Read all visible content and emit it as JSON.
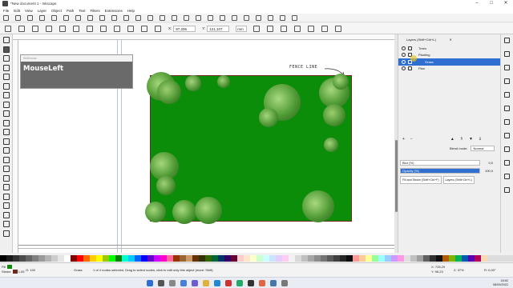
{
  "window": {
    "title": "*New document 1 - Inkscape"
  },
  "menu": [
    "File",
    "Edit",
    "View",
    "Layer",
    "Object",
    "Path",
    "Text",
    "Filters",
    "Extensions",
    "Help"
  ],
  "tool_controls": {
    "x_label": "X:",
    "x_value": "97,206",
    "y_label": "Y:",
    "y_value": "121,107",
    "unit": "mm"
  },
  "overlay": {
    "header": "Shift/mods",
    "text": "MouseLeft"
  },
  "canvas": {
    "annotation": "FENCE LINE"
  },
  "layers_panel": {
    "tab_label": "Layers (Shift+Ctrl+L)",
    "layers": [
      {
        "name": "Trees",
        "selected": false,
        "sub": false
      },
      {
        "name": "Planting",
        "selected": false,
        "sub": false
      },
      {
        "name": "Grass",
        "selected": true,
        "sub": true
      },
      {
        "name": "Plan",
        "selected": false,
        "sub": false
      }
    ],
    "blend_label": "Blend mode:",
    "blend_value": "Normal",
    "blur_label": "Blur (%)",
    "blur_value": "0,0",
    "opacity_label": "Opacity (%)",
    "opacity_value": "100,0",
    "dock_tabs": [
      "Fill and Stroke (Shift+Ctrl+F)",
      "Layers (Shift+Ctrl+L)"
    ]
  },
  "status": {
    "fill_label": "Fill",
    "stroke_label": "Stroke",
    "stroke_width": "1,05",
    "opacity_label": "O:",
    "opacity_value": "100",
    "layer_value": "Grass",
    "message": "1 of 4 nodes selected. Drag to select nodes, click to edit only this object (more: Shift)",
    "cursor_x": "X: 728,29",
    "cursor_y": "Y: 96,23",
    "zoom_label": "Z:",
    "zoom_value": "37%",
    "rotate_label": "R:",
    "rotate_value": "0,00°"
  },
  "colors": {
    "grass": "#0c8d09",
    "fence": "#6a2a1f",
    "selection": "#2f6fd1",
    "overlay": "#6a6a6a"
  },
  "palette": [
    "#000000",
    "#1a1a1a",
    "#333333",
    "#4d4d4d",
    "#666666",
    "#808080",
    "#999999",
    "#b3b3b3",
    "#cccccc",
    "#e6e6e6",
    "#ffffff",
    "#800000",
    "#ff0000",
    "#ff6600",
    "#ffcc00",
    "#ffff00",
    "#99cc00",
    "#00ff00",
    "#008000",
    "#00ffcc",
    "#00ccff",
    "#0066ff",
    "#0000ff",
    "#6600cc",
    "#cc00ff",
    "#ff00cc",
    "#ff6699",
    "#993300",
    "#996633",
    "#cc9966",
    "#663300",
    "#333300",
    "#336600",
    "#006633",
    "#003366",
    "#330066",
    "#660033",
    "#ffcccc",
    "#ffe5cc",
    "#ffffcc",
    "#ccffcc",
    "#ccffff",
    "#cce5ff",
    "#e5ccff",
    "#ffccf2",
    "#f2f2f2",
    "#d9d9d9",
    "#bfbfbf",
    "#a6a6a6",
    "#8c8c8c",
    "#737373",
    "#595959",
    "#404040",
    "#262626",
    "#0d0d0d",
    "#ff9999",
    "#ffcc99",
    "#ffff99",
    "#99ff99",
    "#99ffff",
    "#99ccff",
    "#cc99ff",
    "#ff99e5",
    "#e0e0e0",
    "#c0c0c0",
    "#a0a0a0",
    "#606060",
    "#303030",
    "#101010",
    "#b35900",
    "#80b300",
    "#00b359",
    "#0059b3",
    "#5900b3",
    "#b30059",
    "#ffd9b3"
  ],
  "tray": {
    "time": "18:52",
    "date": "08/09/2022"
  }
}
